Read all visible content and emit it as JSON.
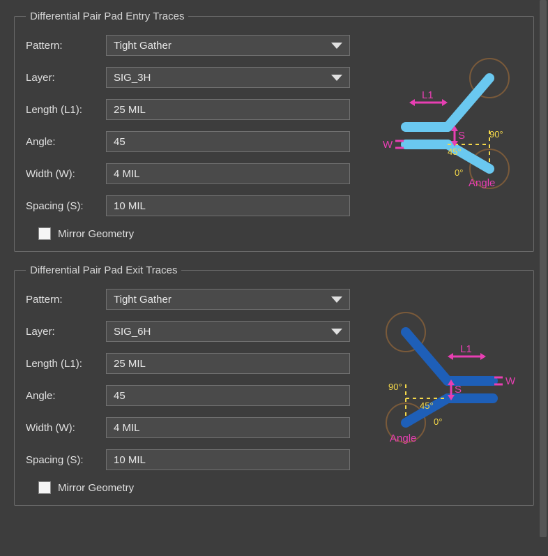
{
  "entry": {
    "legend": "Differential Pair Pad Entry Traces",
    "patternLabel": "Pattern:",
    "patternValue": "Tight Gather",
    "layerLabel": "Layer:",
    "layerValue": "SIG_3H",
    "lengthLabel": "Length (L1):",
    "lengthValue": "25 MIL",
    "angleLabel": "Angle:",
    "angleValue": "45",
    "widthLabel": "Width (W):",
    "widthValue": "4 MIL",
    "spacingLabel": "Spacing (S):",
    "spacingValue": "10 MIL",
    "mirrorLabel": "Mirror Geometry",
    "diagram": {
      "l1": "L1",
      "s": "S",
      "w": "W",
      "a0": "0°",
      "a45": "45°",
      "a90": "90°",
      "angle": "Angle"
    }
  },
  "exit": {
    "legend": "Differential Pair Pad Exit Traces",
    "patternLabel": "Pattern:",
    "patternValue": "Tight Gather",
    "layerLabel": "Layer:",
    "layerValue": "SIG_6H",
    "lengthLabel": "Length (L1):",
    "lengthValue": "25 MIL",
    "angleLabel": "Angle:",
    "angleValue": "45",
    "widthLabel": "Width (W):",
    "widthValue": "4 MIL",
    "spacingLabel": "Spacing (S):",
    "spacingValue": "10 MIL",
    "mirrorLabel": "Mirror Geometry",
    "diagram": {
      "l1": "L1",
      "s": "S",
      "w": "W",
      "a0": "0°",
      "a45": "45°",
      "a90": "90°",
      "angle": "Angle"
    }
  }
}
